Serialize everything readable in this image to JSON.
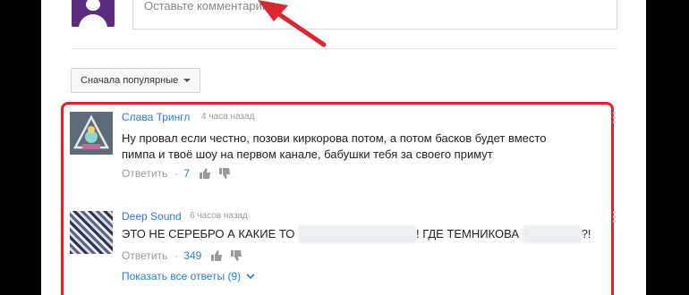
{
  "comment_input": {
    "placeholder": "Оставьте комментарий"
  },
  "sort": {
    "label": "Сначала популярные"
  },
  "comments": [
    {
      "author": "Слава Трингл",
      "time": "4 часа назад",
      "text_line1": "Ну провал если честно, позови киркорова  потом, а потом басков будет вместо",
      "text_line2": "пимпа и твоё шоу на первом канале, бабушки тебя за своего примут",
      "reply_label": "Ответить",
      "bullet": "·",
      "likes": "7"
    },
    {
      "author": "Deep Sound",
      "time": "6 часов назад",
      "text_part1": "ЭТО НЕ СЕРЕБРО А КАКИЕ ТО",
      "text_part2": "! ГДЕ ТЕМНИКОВА",
      "text_part3": "?!",
      "reply_label": "Ответить",
      "bullet": "·",
      "likes": "349",
      "show_replies": "Показать все ответы (9)"
    }
  ],
  "colors": {
    "highlight": "#e0222b",
    "link": "#2b7bd3",
    "arrow": "#d9282f"
  }
}
